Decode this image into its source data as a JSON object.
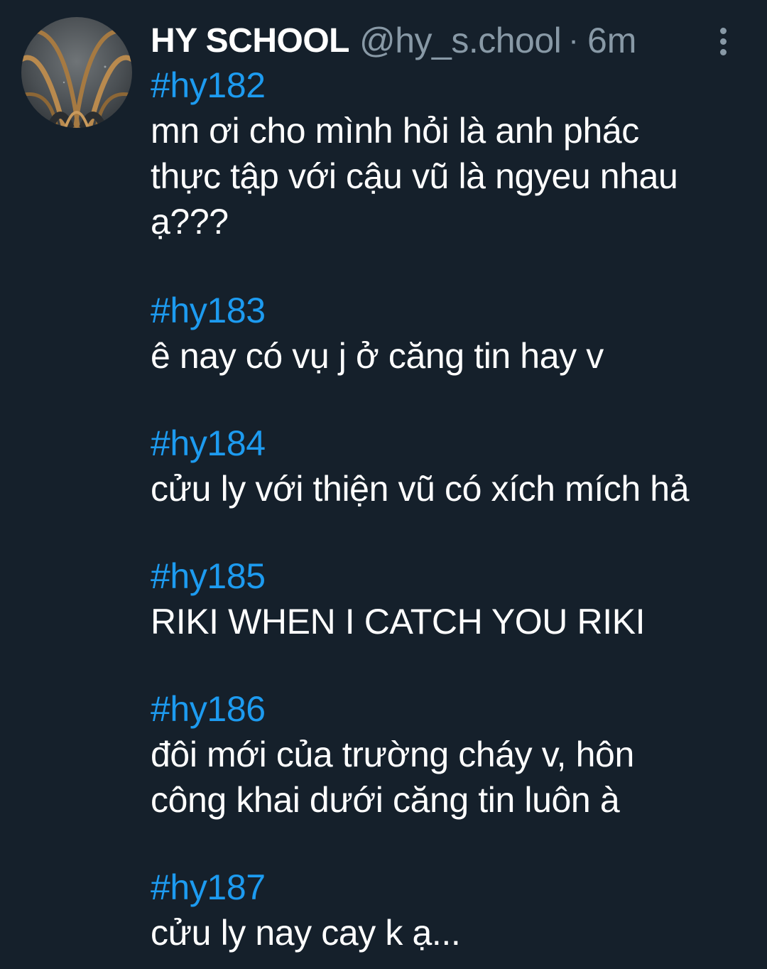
{
  "tweet": {
    "author_name": "HY SCHOOL",
    "author_handle": "@hy_s.chool",
    "separator": "·",
    "time": "6m",
    "posts": [
      {
        "hashtag": "#hy182",
        "lines": [
          "mn ơi cho mình hỏi là anh phác",
          "thực tập với cậu vũ là ngyeu nhau",
          "ạ???"
        ]
      },
      {
        "hashtag": "#hy183",
        "lines": [
          "ê nay có vụ j ở căng tin hay v"
        ]
      },
      {
        "hashtag": "#hy184",
        "lines": [
          "cửu ly với thiện vũ có xích mích hả"
        ]
      },
      {
        "hashtag": "#hy185",
        "lines": [
          "RIKI WHEN I CATCH YOU RIKI"
        ]
      },
      {
        "hashtag": "#hy186",
        "lines": [
          "đôi mới của trường cháy v, hôn",
          "công khai dưới căng tin luôn à"
        ]
      },
      {
        "hashtag": "#hy187",
        "lines": [
          "cửu ly nay cay k ạ..."
        ]
      }
    ]
  },
  "icons": {
    "more": "more-vertical-icon",
    "avatar": "gothic-arch-avatar"
  },
  "colors": {
    "background": "#15202b",
    "hashtag": "#1d9bf0",
    "secondary_text": "#8899a6",
    "primary_text": "#ffffff"
  }
}
